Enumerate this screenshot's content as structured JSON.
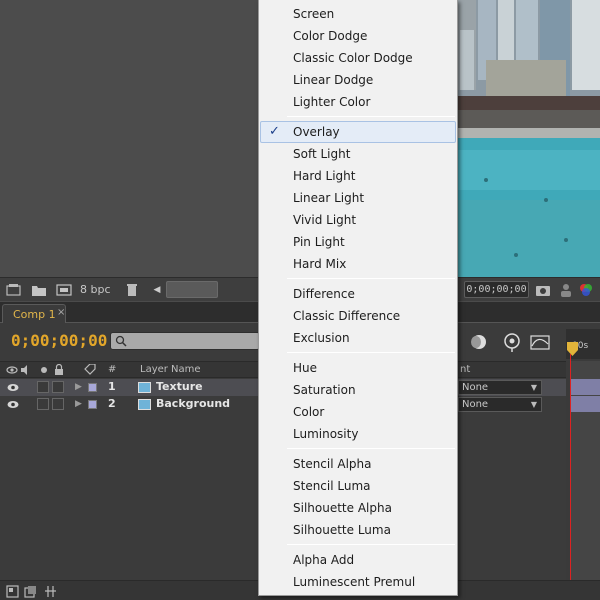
{
  "project_toolbar": {
    "bpc": "8 bpc",
    "timecode": "0;00;00;00"
  },
  "timeline": {
    "tab_label": "Comp 1",
    "tab_close": "×",
    "time": "0;00;00;00",
    "ruler_label": "00s",
    "columns": {
      "hash": "#",
      "layer_name": "Layer Name",
      "t": "nt"
    },
    "layers": [
      {
        "num": "1",
        "name": "Texture",
        "parent": "None",
        "selected": true
      },
      {
        "num": "2",
        "name": "Background",
        "parent": "None",
        "selected": false
      }
    ]
  },
  "blend_menu": {
    "checked_item": "Overlay",
    "groups": [
      [
        "Screen",
        "Color Dodge",
        "Classic Color Dodge",
        "Linear Dodge",
        "Lighter Color"
      ],
      [
        "Overlay",
        "Soft Light",
        "Hard Light",
        "Linear Light",
        "Vivid Light",
        "Pin Light",
        "Hard Mix"
      ],
      [
        "Difference",
        "Classic Difference",
        "Exclusion"
      ],
      [
        "Hue",
        "Saturation",
        "Color",
        "Luminosity"
      ],
      [
        "Stencil Alpha",
        "Stencil Luma",
        "Silhouette Alpha",
        "Silhouette Luma"
      ],
      [
        "Alpha Add",
        "Luminescent Premul"
      ]
    ]
  },
  "colors": {
    "timecode_orange": "#e2a62a",
    "tab_gold": "#e2b64b",
    "layer_label": "#a8a8d8",
    "playhead": "#dd2222",
    "menu_check": "#1c3f8a"
  }
}
